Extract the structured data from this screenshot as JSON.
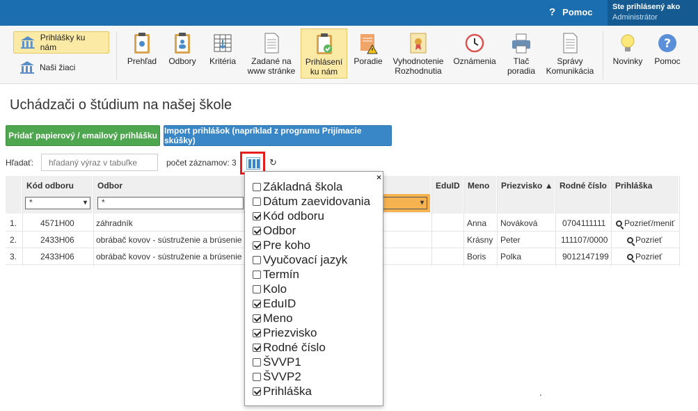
{
  "topbar": {
    "help": "Pomoc",
    "user_line1": "Ste prihlásený ako",
    "user_line2": "Administrátor"
  },
  "toolbar": {
    "side": [
      {
        "label": "Prihlášky ku nám",
        "active": true
      },
      {
        "label": "Naši žiaci",
        "active": false
      }
    ],
    "items": [
      {
        "label": "Prehľad"
      },
      {
        "label": "Odbory"
      },
      {
        "label": "Kritéria"
      },
      {
        "label": "Zadané na www stránke"
      },
      {
        "label": "Prihlásení ku nám",
        "active": true
      },
      {
        "label": "Poradie"
      },
      {
        "label": "Vyhodnotenie Rozhodnutia"
      },
      {
        "label": "Oznámenia"
      },
      {
        "label": "Tlač poradia"
      },
      {
        "label": "Správy Komunikácia"
      },
      {
        "label": "Novinky"
      },
      {
        "label": "Pomoc"
      }
    ]
  },
  "page": {
    "title": "Uchádzači o štúdium na našej škole",
    "add_button": "Pridať papierový / emailový prihlášku",
    "import_button": "Import prihlášok (napríklad z programu Prijímacie skúšky)",
    "search_label": "Hľadať:",
    "search_placeholder": "hľadaný výraz v tabuľke",
    "record_count": "počet záznamov: 3"
  },
  "table": {
    "headers": [
      "Kód odboru",
      "Odbor",
      "EduID",
      "Meno",
      "Priezvisko ▲",
      "Rodné číslo",
      "Prihláška"
    ],
    "filters": [
      "*",
      "*"
    ],
    "rows": [
      {
        "num": "1.",
        "kod": "4571H00",
        "odbor": "záhradník",
        "meno": "Anna",
        "priezvisko": "Nováková",
        "rodne": "0704111111",
        "akcia": "Pozrieť/meniť"
      },
      {
        "num": "2.",
        "kod": "2433H06",
        "odbor": "obrábač kovov - sústruženie a brúsenie",
        "meno": "Krásny",
        "priezvisko": "Peter",
        "rodne": "111107/0000",
        "akcia": "Pozrieť"
      },
      {
        "num": "3.",
        "kod": "2433H06",
        "odbor": "obrábač kovov - sústruženie a brúsenie",
        "meno": "Boris",
        "priezvisko": "Polka",
        "rodne": "9012147199",
        "akcia": "Pozrieť"
      }
    ]
  },
  "columns_menu": {
    "close": "×",
    "options": [
      {
        "label": "Základná škola",
        "checked": false
      },
      {
        "label": "Dátum zaevidovania",
        "checked": false
      },
      {
        "label": "Kód odboru",
        "checked": true
      },
      {
        "label": "Odbor",
        "checked": true
      },
      {
        "label": "Pre koho",
        "checked": true
      },
      {
        "label": "Vyučovací jazyk",
        "checked": false
      },
      {
        "label": "Termín",
        "checked": false
      },
      {
        "label": "Kolo",
        "checked": false
      },
      {
        "label": "EduID",
        "checked": true
      },
      {
        "label": "Meno",
        "checked": true
      },
      {
        "label": "Priezvisko",
        "checked": true
      },
      {
        "label": "Rodné číslo",
        "checked": true
      },
      {
        "label": "ŠVVP1",
        "checked": false
      },
      {
        "label": "ŠVVP2",
        "checked": false
      },
      {
        "label": "Prihláška",
        "checked": true
      }
    ]
  },
  "footer_dot": "."
}
